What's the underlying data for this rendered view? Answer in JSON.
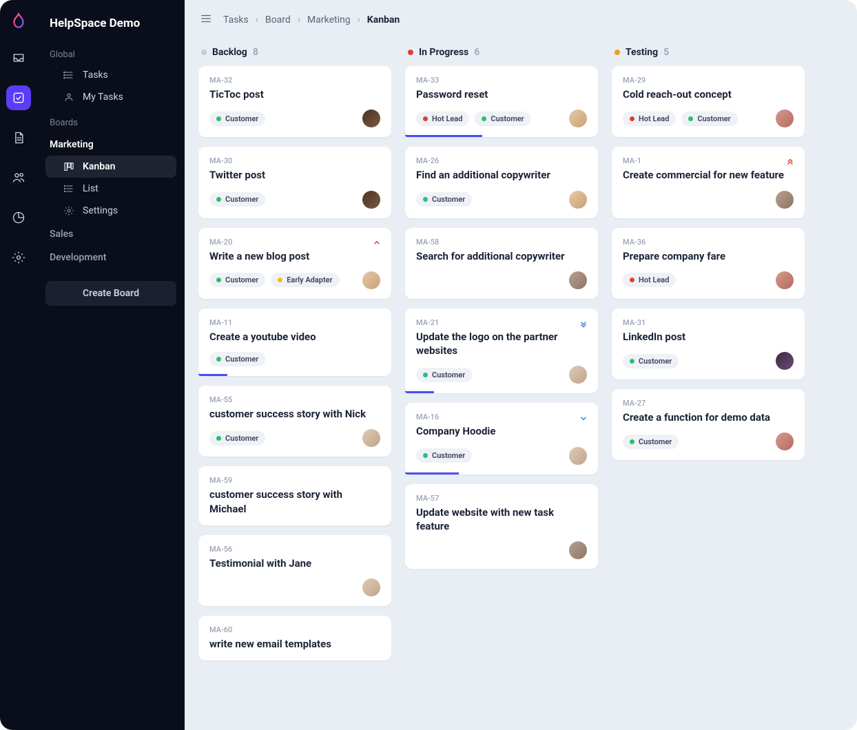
{
  "app_title": "HelpSpace Demo",
  "sidebar": {
    "global_label": "Global",
    "tasks_label": "Tasks",
    "mytasks_label": "My Tasks",
    "boards_label": "Boards",
    "marketing_label": "Marketing",
    "kanban_label": "Kanban",
    "list_label": "List",
    "settings_label": "Settings",
    "sales_label": "Sales",
    "development_label": "Development",
    "create_board": "Create Board"
  },
  "breadcrumb": {
    "a": "Tasks",
    "b": "Board",
    "c": "Marketing",
    "d": "Kanban"
  },
  "columns": [
    {
      "key": "backlog",
      "title": "Backlog",
      "count": "8",
      "dot": "grey"
    },
    {
      "key": "inprogress",
      "title": "In Progress",
      "count": "6",
      "dot": "red"
    },
    {
      "key": "testing",
      "title": "Testing",
      "count": "5",
      "dot": "orange"
    }
  ],
  "tags": {
    "customer": "Customer",
    "hotlead": "Hot Lead",
    "earlyadapter": "Early Adapter"
  },
  "cards": {
    "backlog": [
      {
        "id": "MA-32",
        "title": "TicToc post",
        "tags": [
          "customer"
        ],
        "avatar": "a1"
      },
      {
        "id": "MA-30",
        "title": "Twitter post",
        "tags": [
          "customer"
        ],
        "avatar": "a1"
      },
      {
        "id": "MA-20",
        "title": "Write a new blog post",
        "tags": [
          "customer",
          "earlyadapter"
        ],
        "avatar": "a2",
        "prio": "up-red"
      },
      {
        "id": "MA-11",
        "title": "Create a youtube video",
        "tags": [
          "customer"
        ],
        "progress": 15
      },
      {
        "id": "MA-55",
        "title": "customer success story with Nick",
        "tags": [
          "customer"
        ],
        "avatar": "a5"
      },
      {
        "id": "MA-59",
        "title": "customer success story with Michael",
        "tags": []
      },
      {
        "id": "MA-56",
        "title": "Testimonial with Jane",
        "tags": [],
        "avatar": "a5"
      },
      {
        "id": "MA-60",
        "title": "write new email templates",
        "tags": []
      }
    ],
    "inprogress": [
      {
        "id": "MA-33",
        "title": "Password reset",
        "tags": [
          "hotlead",
          "customer"
        ],
        "avatar": "a2",
        "progress": 40
      },
      {
        "id": "MA-26",
        "title": "Find an additional copywriter",
        "tags": [
          "customer"
        ],
        "avatar": "a2"
      },
      {
        "id": "MA-58",
        "title": "Search for additional copywriter",
        "tags": [],
        "avatar": "a4"
      },
      {
        "id": "MA-21",
        "title": "Update the logo on the partner websites",
        "tags": [
          "customer"
        ],
        "avatar": "a5",
        "prio": "down-blue",
        "progress": 15
      },
      {
        "id": "MA-16",
        "title": "Company Hoodie",
        "tags": [
          "customer"
        ],
        "avatar": "a5",
        "prio": "down-blue-single",
        "progress": 28
      },
      {
        "id": "MA-57",
        "title": "Update website with new task feature",
        "tags": [],
        "avatar": "a4"
      }
    ],
    "testing": [
      {
        "id": "MA-29",
        "title": "Cold reach-out concept",
        "tags": [
          "hotlead",
          "customer"
        ],
        "avatar": "a3"
      },
      {
        "id": "MA-1",
        "title": "Create commercial for new feature",
        "tags": [],
        "avatar": "a4",
        "prio": "up-red-double"
      },
      {
        "id": "MA-36",
        "title": "Prepare company fare",
        "tags": [
          "hotlead"
        ],
        "avatar": "a3"
      },
      {
        "id": "MA-31",
        "title": "LinkedIn post",
        "tags": [
          "customer"
        ],
        "avatar": "a6"
      },
      {
        "id": "MA-27",
        "title": "Create a function for demo data",
        "tags": [
          "customer"
        ],
        "avatar": "a3"
      }
    ]
  }
}
